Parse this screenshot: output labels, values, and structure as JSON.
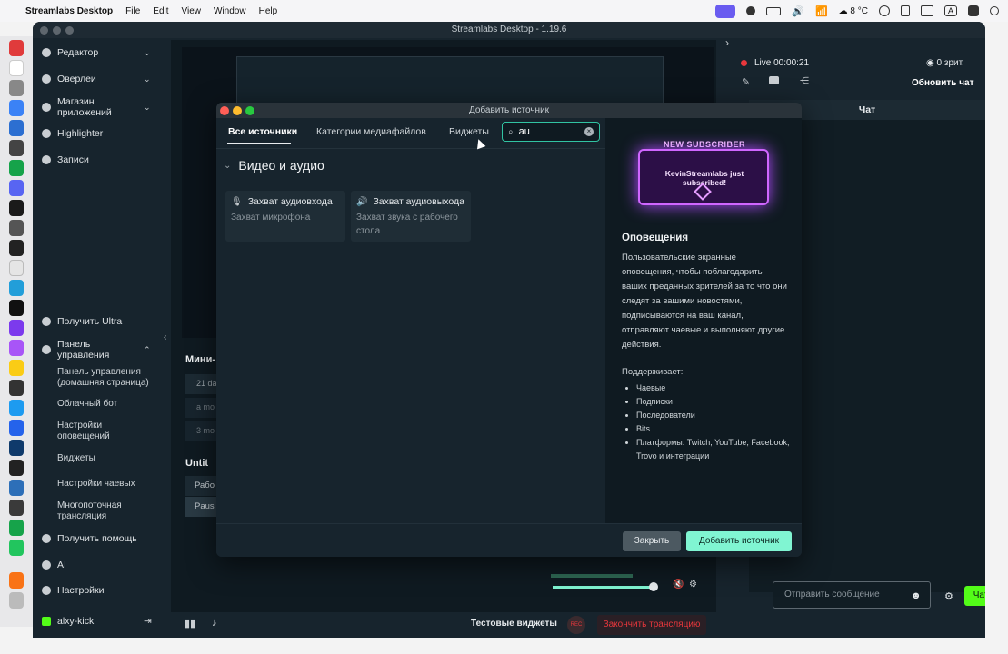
{
  "menubar": {
    "app_name": "Streamlabs Desktop",
    "items": [
      "File",
      "Edit",
      "View",
      "Window",
      "Help"
    ],
    "temperature": "8 °C",
    "input_letter": "A"
  },
  "window": {
    "title": "Streamlabs Desktop - 1.19.6"
  },
  "sidebar": {
    "items": [
      {
        "label": "Редактор"
      },
      {
        "label": "Оверлеи"
      },
      {
        "label": "Магазин приложений"
      },
      {
        "label": "Highlighter"
      },
      {
        "label": "Записи"
      },
      {
        "label": "Получить Ultra"
      },
      {
        "label": "Панель управления"
      },
      {
        "label": "Получить помощь"
      },
      {
        "label": "AI"
      },
      {
        "label": "Настройки"
      }
    ],
    "subitems": [
      {
        "label": "Панель управления (домашняя страница)"
      },
      {
        "label": "Облачный бот"
      },
      {
        "label": "Настройки оповещений"
      },
      {
        "label": "Виджеты"
      },
      {
        "label": "Настройки чаевых"
      },
      {
        "label": "Многопоточная трансляция"
      }
    ],
    "user": "alxy-kick"
  },
  "editor": {
    "mini_title": "Мини-",
    "mini_rows": [
      "21 da",
      "a mo",
      "3 mo"
    ],
    "scene_title": "Untit",
    "scene_rows": [
      "Рабо",
      "Paus"
    ]
  },
  "chat": {
    "live_time": "Live 00:00:21",
    "viewers": "0 зрит.",
    "refresh": "Обновить чат",
    "header": "Чат",
    "placeholder": "Отправить сообщение",
    "send": "Чат"
  },
  "bottom": {
    "test_widgets": "Тестовые виджеты",
    "rec": "REC",
    "end_stream": "Закончить трансляцию"
  },
  "modal": {
    "title": "Добавить источник",
    "tabs": [
      "Все источники",
      "Категории медиафайлов",
      "Виджеты"
    ],
    "search_value": "au",
    "group": "Видео и аудио",
    "sources": [
      {
        "name": "Захват аудиовхода",
        "desc": "Захват микрофона"
      },
      {
        "name": "Захват аудиовыхода",
        "desc": "Захват звука с рабочего стола"
      }
    ],
    "promo": {
      "top": "NEW SUBSCRIBER",
      "message": "KevinStreamlabs just subscribed!"
    },
    "info_title": "Оповещения",
    "info_desc": "Пользовательские экранные оповещения, чтобы поблагодарить ваших преданных зрителей за то что они следят за вашими новостями, подписываются на ваш канал, отправляют чаевые и выполняют другие действия.",
    "supports_label": "Поддерживает:",
    "supports": [
      "Чаевые",
      "Подписки",
      "Последователи",
      "Bits",
      "Платформы: Twitch, YouTube, Facebook, Trovo и интеграции"
    ],
    "close": "Закрыть",
    "add": "Добавить источник"
  },
  "colors": {
    "accent": "#80f5d2",
    "live": "#e8373c",
    "bg": "#17242d"
  }
}
